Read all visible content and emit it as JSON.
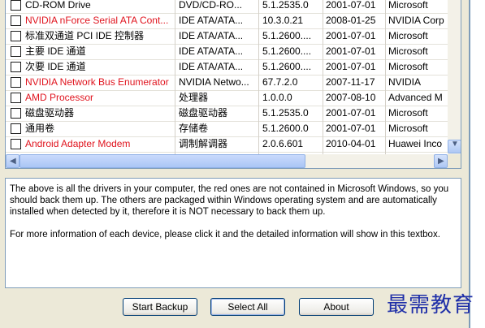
{
  "drivers": {
    "rows": [
      {
        "name": "CD-ROM Drive",
        "class": "DVD/CD-RO...",
        "version": "5.1.2535.0",
        "date": "2001-07-01",
        "provider": "Microsoft",
        "red": false
      },
      {
        "name": "NVIDIA nForce Serial ATA Cont...",
        "class": "IDE ATA/ATA...",
        "version": "10.3.0.21",
        "date": "2008-01-25",
        "provider": "NVIDIA Corp",
        "red": true
      },
      {
        "name": "标准双通道 PCI IDE 控制器",
        "class": "IDE ATA/ATA...",
        "version": "5.1.2600....",
        "date": "2001-07-01",
        "provider": "Microsoft",
        "red": false
      },
      {
        "name": "主要 IDE 通道",
        "class": "IDE ATA/ATA...",
        "version": "5.1.2600....",
        "date": "2001-07-01",
        "provider": "Microsoft",
        "red": false
      },
      {
        "name": "次要 IDE 通道",
        "class": "IDE ATA/ATA...",
        "version": "5.1.2600....",
        "date": "2001-07-01",
        "provider": "Microsoft",
        "red": false
      },
      {
        "name": "NVIDIA Network Bus Enumerator",
        "class": "NVIDIA Netwo...",
        "version": "67.7.2.0",
        "date": "2007-11-17",
        "provider": "NVIDIA",
        "red": true
      },
      {
        "name": "AMD Processor",
        "class": "处理器",
        "version": "1.0.0.0",
        "date": "2007-08-10",
        "provider": "Advanced M",
        "red": true
      },
      {
        "name": "磁盘驱动器",
        "class": "磁盘驱动器",
        "version": "5.1.2535.0",
        "date": "2001-07-01",
        "provider": "Microsoft",
        "red": false
      },
      {
        "name": "通用卷",
        "class": "存储卷",
        "version": "5.1.2600.0",
        "date": "2001-07-01",
        "provider": "Microsoft",
        "red": false
      },
      {
        "name": "Android Adapter Modem",
        "class": "调制解调器",
        "version": "2.0.6.601",
        "date": "2010-04-01",
        "provider": "Huawei Inco",
        "red": true
      }
    ]
  },
  "info": {
    "paragraph1": "The above is all the drivers in your computer, the red ones are not contained in Microsoft Windows, so you should back them up. The others are packaged within Windows operating system and are automatically installed when detected by it, therefore it is NOT necessary to back them up.",
    "paragraph2": "For more information of each device, please click it and the detailed information will show in this textbox."
  },
  "buttons": {
    "start_backup": "Start Backup",
    "select_all": "Select All",
    "about": "About"
  },
  "watermark": "最需教育",
  "colors": {
    "red_driver": "#e0141e",
    "border": "#7f9db9"
  }
}
